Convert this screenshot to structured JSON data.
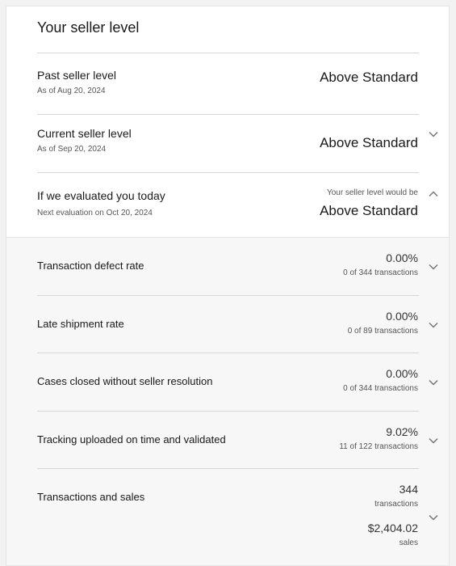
{
  "page": {
    "title": "Your seller level"
  },
  "past": {
    "label": "Past seller level",
    "sub": "As of Aug 20, 2024",
    "value": "Above Standard"
  },
  "current": {
    "label": "Current seller level",
    "sub": "As of Sep 20, 2024",
    "value": "Above Standard",
    "icon": "chevron-down-icon"
  },
  "today": {
    "label": "If we evaluated you today",
    "sub": "Next evaluation on Oct 20, 2024",
    "prefix": "Your seller level would be",
    "value": "Above Standard",
    "icon": "chevron-up-icon"
  },
  "metrics": [
    {
      "label": "Transaction defect rate",
      "value": "0.00%",
      "sub": "0 of 344 transactions",
      "icon": "chevron-down-icon"
    },
    {
      "label": "Late shipment rate",
      "value": "0.00%",
      "sub": "0 of 89 transactions",
      "icon": "chevron-down-icon"
    },
    {
      "label": "Cases closed without seller resolution",
      "value": "0.00%",
      "sub": "0 of 344 transactions",
      "icon": "chevron-down-icon"
    },
    {
      "label": "Tracking uploaded on time and validated",
      "value": "9.02%",
      "sub": "11 of 122 transactions",
      "icon": "chevron-down-icon"
    }
  ],
  "sales": {
    "label": "Transactions and sales",
    "transactions_value": "344",
    "transactions_unit": "transactions",
    "sales_value": "$2,404.02",
    "sales_unit": "sales",
    "icon": "chevron-down-icon"
  },
  "colors": {
    "divider": "#d6d6d6",
    "gray_background": "#f7f7f7",
    "text": "#191919",
    "subtext": "#555555"
  }
}
